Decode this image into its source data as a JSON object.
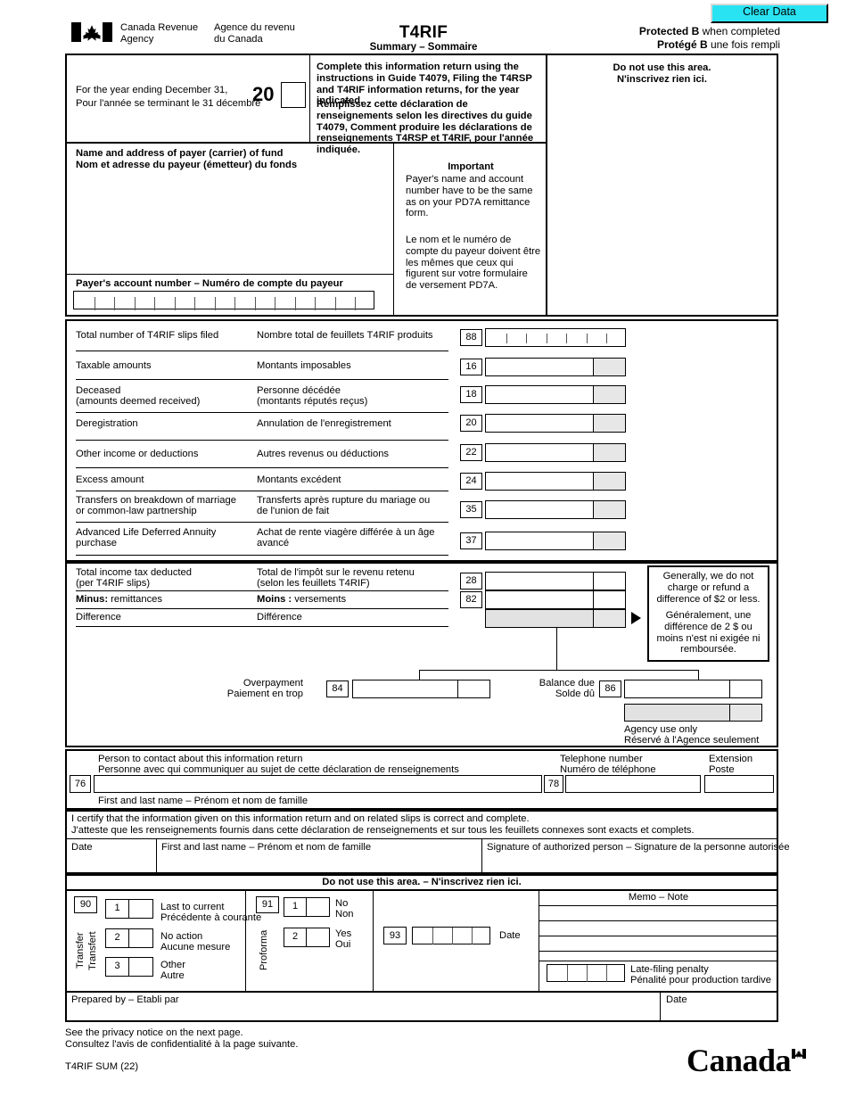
{
  "window": {
    "clear_data_label": "Clear Data"
  },
  "header": {
    "agency_en": "Canada Revenue\nAgency",
    "agency_en_l1": "Canada Revenue",
    "agency_en_l2": "Agency",
    "agency_fr_l1": "Agence du revenu",
    "agency_fr_l2": "du Canada",
    "title": "T4RIF",
    "subtitle": "Summary  –  Sommaire",
    "protected_en_bold": "Protected B",
    "protected_en_rest": " when completed",
    "protected_fr_bold": "Protégé B",
    "protected_fr_rest": " une fois rempli"
  },
  "year_block": {
    "label_en": "For the year ending December 31,",
    "label_fr": "Pour l'année se terminant le 31 décembre",
    "century": "20",
    "year_value": ""
  },
  "instructions": {
    "en": "Complete this information return using the instructions in Guide T4079, Filing the T4RSP and T4RIF information returns, for the year indicated.",
    "fr": "Remplissez cette déclaration de renseignements selon les directives du guide T4079, Comment produire les déclarations de renseignements T4RSP et T4RIF, pour l'année indiquée."
  },
  "do_not_use_top": {
    "en": "Do not use this area.",
    "fr": "N'inscrivez rien ici."
  },
  "payer": {
    "name_label_en": "Name and address of payer (carrier) of fund",
    "name_label_fr": "Nom et adresse du payeur (émetteur) du fonds",
    "name_value": "",
    "account_label": "Payer's account number  –  Numéro de compte du payeur",
    "account_value": "",
    "account_cells": 15
  },
  "important": {
    "title": "Important",
    "en": "Payer's name and account number have to be the same as on your PD7A remittance form.",
    "fr": "Le nom et le numéro de compte du payeur doivent être les mêmes que ceux qui figurent sur votre formulaire de versement PD7A."
  },
  "amount_lines": [
    {
      "label_en": "Total number of T4RIF slips filed",
      "label_en2": "",
      "label_fr": "Nombre total de feuillets T4RIF produits",
      "label_fr2": "",
      "box": "88",
      "value": "",
      "style": "cells",
      "cells": 7
    },
    {
      "label_en": "Taxable amounts",
      "label_en2": "",
      "label_fr": "Montants imposables",
      "label_fr2": "",
      "box": "16",
      "value": "",
      "style": "money"
    },
    {
      "label_en": "Deceased",
      "label_en2": "(amounts deemed received)",
      "label_fr": "Personne décédée",
      "label_fr2": "(montants réputés reçus)",
      "box": "18",
      "value": "",
      "style": "money"
    },
    {
      "label_en": "Deregistration",
      "label_en2": "",
      "label_fr": "Annulation de l'enregistrement",
      "label_fr2": "",
      "box": "20",
      "value": "",
      "style": "money"
    },
    {
      "label_en": "Other income or deductions",
      "label_en2": "",
      "label_fr": "Autres revenus ou déductions",
      "label_fr2": "",
      "box": "22",
      "value": "",
      "style": "money"
    },
    {
      "label_en": "Excess amount",
      "label_en2": "",
      "label_fr": "Montants excédent",
      "label_fr2": "",
      "box": "24",
      "value": "",
      "style": "money"
    },
    {
      "label_en": "Transfers on breakdown of marriage",
      "label_en2": "or common-law partnership",
      "label_fr": "Transferts après rupture du mariage ou",
      "label_fr2": "de l'union de fait",
      "box": "35",
      "value": "",
      "style": "money"
    },
    {
      "label_en": "Advanced Life Deferred Annuity",
      "label_en2": "purchase",
      "label_fr": "Achat de rente viagère différée à un âge",
      "label_fr2": "avancé",
      "box": "37",
      "value": "",
      "style": "money"
    }
  ],
  "tax_section": {
    "rows": [
      {
        "label_en": "Total income tax deducted",
        "label_en2": "(per T4RIF slips)",
        "label_fr": "Total de l'impôt sur le revenu retenu",
        "label_fr2": "(selon les feuillets T4RIF)",
        "box": "28",
        "value": ""
      },
      {
        "label_en_bold": "Minus:",
        "label_en": " remittances",
        "label_en2": "",
        "label_fr_bold": "Moins :",
        "label_fr": " versements",
        "label_fr2": "",
        "box": "82",
        "value": ""
      },
      {
        "label_en": "Difference",
        "label_en2": "",
        "label_fr": "Différence",
        "label_fr2": "",
        "box": "",
        "value": ""
      }
    ],
    "note_en": "Generally, we do not charge or refund a difference of $2 or less.",
    "note_fr": "Généralement, une différence de 2 $ ou moins n'est ni exigée ni remboursée.",
    "overpayment_en": "Overpayment",
    "overpayment_fr": "Paiement en trop",
    "overpayment_box": "84",
    "overpayment_value": "",
    "balance_due_en": "Balance due",
    "balance_due_fr": "Solde dû",
    "balance_due_box": "86",
    "balance_due_value": "",
    "agency_use_en": "Agency use only",
    "agency_use_fr": "Réservé à l'Agence seulement"
  },
  "contact": {
    "label_en": "Person to contact about this information return",
    "label_fr": "Personne avec qui communiquer au sujet de cette déclaration de renseignements",
    "name_box": "76",
    "name_value": "",
    "name_hint": "First and last name – Prénom et nom de famille",
    "phone_label_en": "Telephone number",
    "phone_label_fr": "Numéro de téléphone",
    "phone_box": "78",
    "phone_value": "",
    "ext_label_en": "Extension",
    "ext_label_fr": "Poste",
    "ext_value": ""
  },
  "certification": {
    "en": "I certify that the information given on this information return and on related slips is correct and complete.",
    "fr": "J'atteste que les renseignements fournis dans cette déclaration de renseignements et sur tous les feuillets connexes sont exacts et complets.",
    "date_label": "Date",
    "date_value": "",
    "name_label": "First and last name – Prénom et nom de famille",
    "name_value": "",
    "signature_label": "Signature of authorized person – Signature de la personne autorisée",
    "signature_value": ""
  },
  "do_not_use_bottom": "Do not use this area. – N'inscrivez rien ici.",
  "agency_area": {
    "transfer_box": "90",
    "transfer_vert_en": "Transfer",
    "transfer_vert_fr": "Transfert",
    "transfer_options": [
      {
        "num": "1",
        "value": "",
        "label_en": "Last to current",
        "label_fr": "Précédente à courante"
      },
      {
        "num": "2",
        "value": "",
        "label_en": "No action",
        "label_fr": "Aucune mesure"
      },
      {
        "num": "3",
        "value": "",
        "label_en": "Other",
        "label_fr": "Autre"
      }
    ],
    "proforma_box": "91",
    "proforma_vert": "Proforma",
    "proforma_options": [
      {
        "num": "1",
        "value": "",
        "label_en": "No",
        "label_fr": "Non"
      },
      {
        "num": "2",
        "value": "",
        "label_en": "Yes",
        "label_fr": "Oui"
      }
    ],
    "date_box": "93",
    "date_value": "",
    "date_label": "Date",
    "memo_title": "Memo – Note",
    "memo_lines": [
      "",
      "",
      "",
      ""
    ],
    "penalty_value": "",
    "penalty_label_en": "Late-filing penalty",
    "penalty_label_fr": "Pénalité pour production tardive"
  },
  "prepared": {
    "label": "Prepared by – Etabli par",
    "value": "",
    "date_label": "Date",
    "date_value": ""
  },
  "footer": {
    "privacy_en": "See the privacy notice on the next page.",
    "privacy_fr": "Consultez l'avis de confidentialité à la page suivante.",
    "form_code": "T4RIF SUM (22)",
    "wordmark": "Canada"
  },
  "colors": {
    "clear_data_bg": "#2ae3f2",
    "shaded_field": "#e2e2e2",
    "ink": "#000000"
  }
}
